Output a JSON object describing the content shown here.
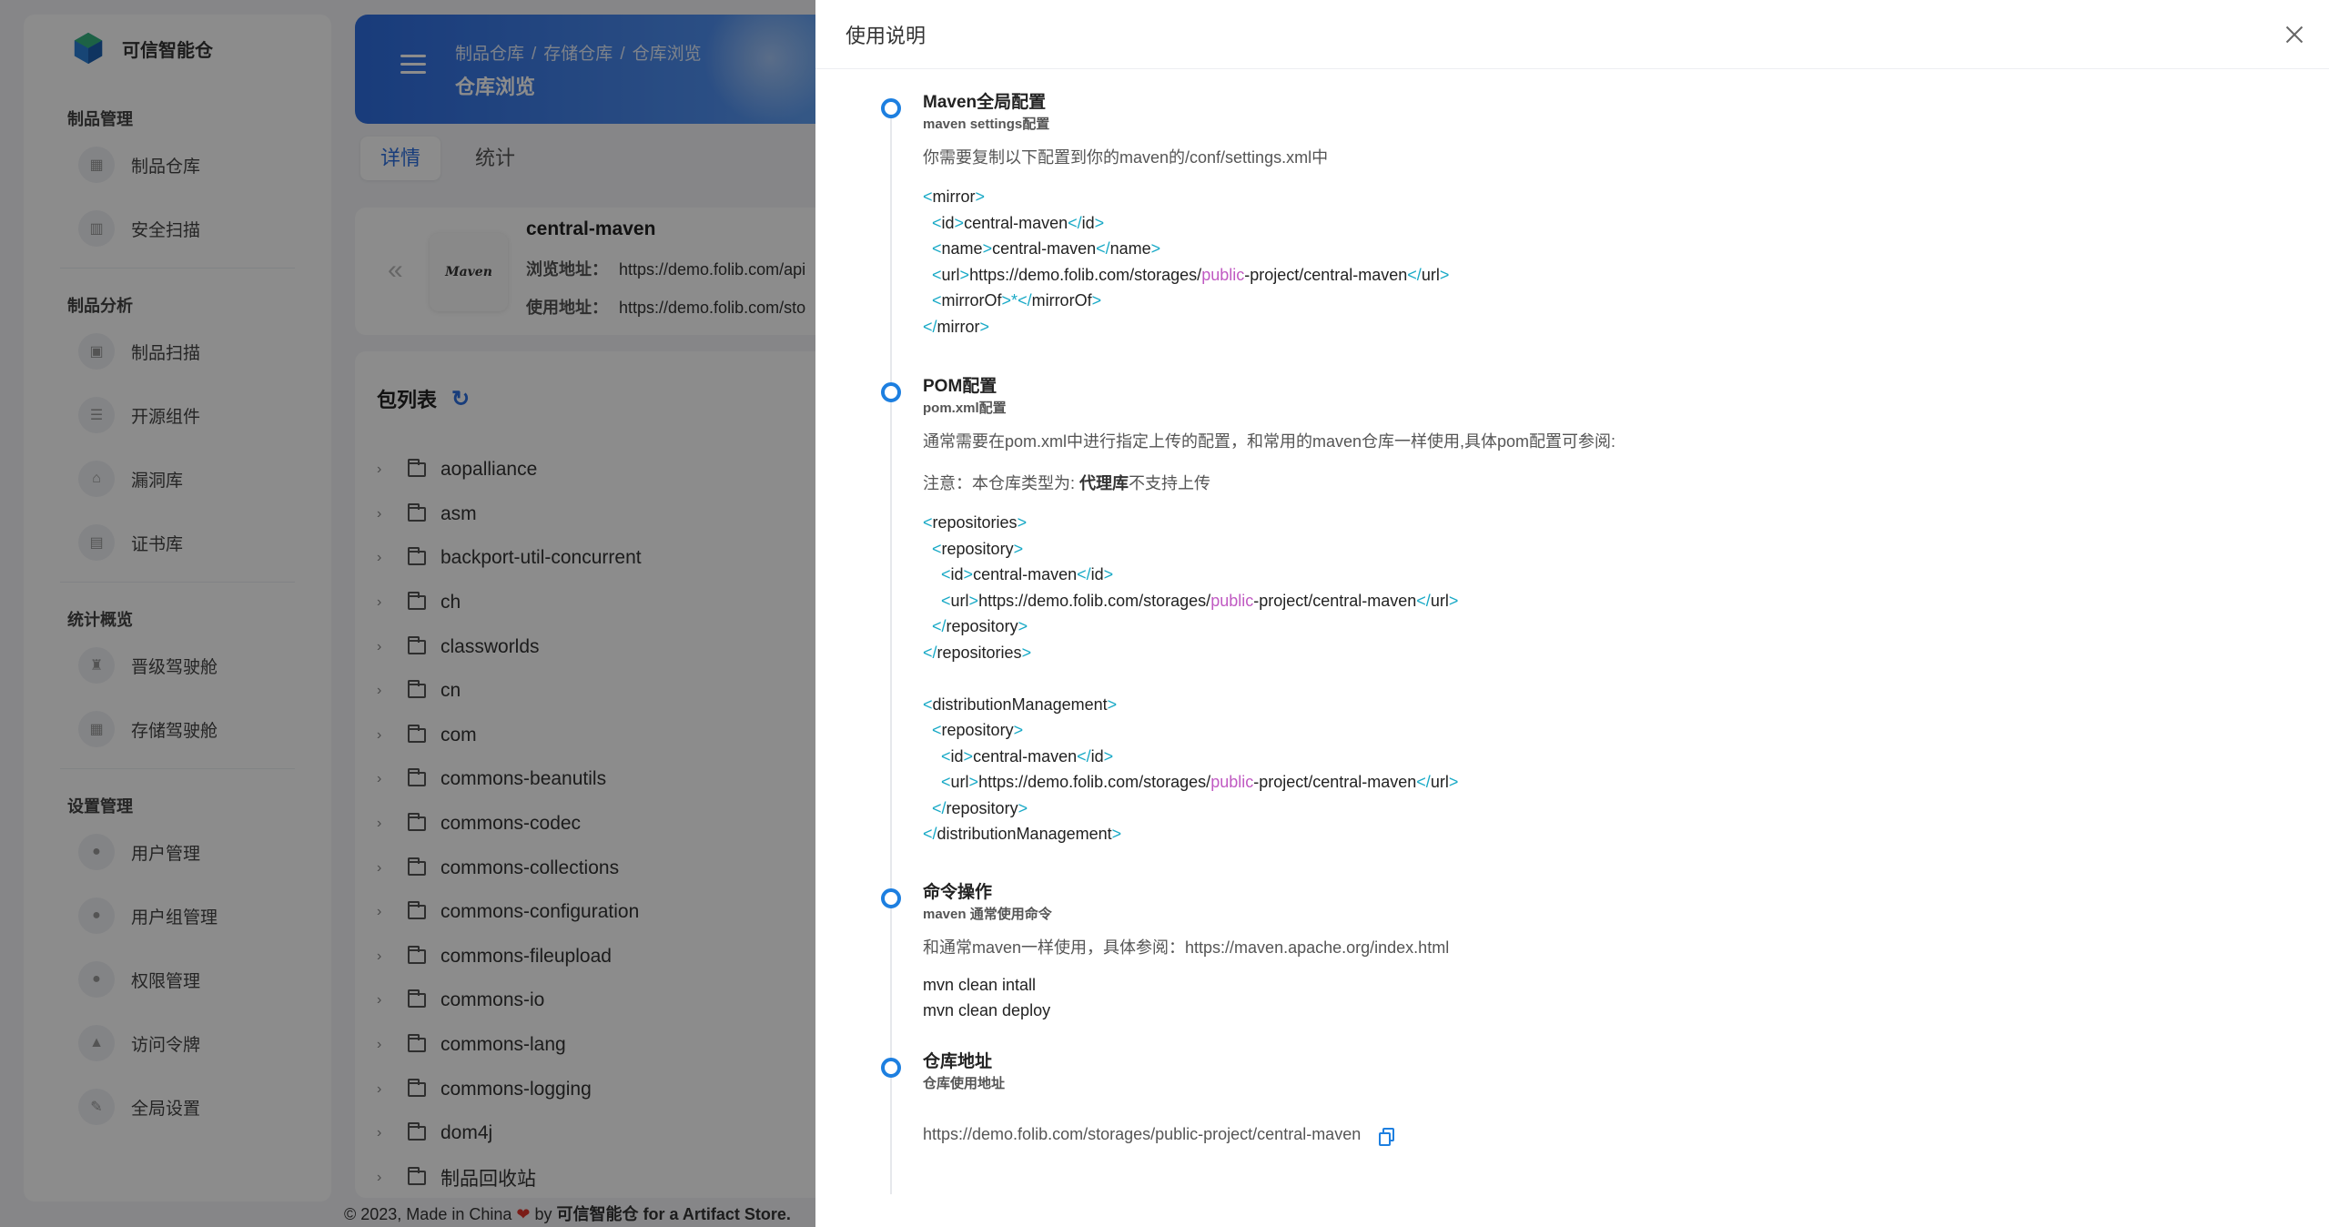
{
  "brand": {
    "name": "可信智能仓"
  },
  "sidebar": {
    "sections": [
      {
        "title": "制品管理",
        "items": [
          {
            "label": "制品仓库"
          },
          {
            "label": "安全扫描"
          }
        ]
      },
      {
        "title": "制品分析",
        "items": [
          {
            "label": "制品扫描"
          },
          {
            "label": "开源组件"
          },
          {
            "label": "漏洞库"
          },
          {
            "label": "证书库"
          }
        ]
      },
      {
        "title": "统计概览",
        "items": [
          {
            "label": "晋级驾驶舱"
          },
          {
            "label": "存储驾驶舱"
          }
        ]
      },
      {
        "title": "设置管理",
        "items": [
          {
            "label": "用户管理"
          },
          {
            "label": "用户组管理"
          },
          {
            "label": "权限管理"
          },
          {
            "label": "访问令牌"
          },
          {
            "label": "全局设置"
          }
        ]
      }
    ]
  },
  "header": {
    "breadcrumbs": [
      "制品仓库",
      "存储仓库",
      "仓库浏览"
    ],
    "title": "仓库浏览"
  },
  "tabs": [
    {
      "label": "详情"
    },
    {
      "label": "统计"
    }
  ],
  "repo": {
    "logo_text": "Maven",
    "name": "central-maven",
    "browse_label": "浏览地址：",
    "browse_url": "https://demo.folib.com/api",
    "use_label": "使用地址：",
    "use_url": "https://demo.folib.com/sto"
  },
  "packages": {
    "title": "包列表",
    "items": [
      "aopalliance",
      "asm",
      "backport-util-concurrent",
      "ch",
      "classworlds",
      "cn",
      "com",
      "commons-beanutils",
      "commons-codec",
      "commons-collections",
      "commons-configuration",
      "commons-fileupload",
      "commons-io",
      "commons-lang",
      "commons-logging",
      "dom4j",
      "制品回收站"
    ]
  },
  "footer": {
    "prefix": "© 2023, Made in China",
    "heart": "❤",
    "by": "by",
    "brand": "可信智能仓",
    "suffix": "for a Artifact Store."
  },
  "drawer": {
    "title": "使用说明",
    "steps": [
      {
        "title": "Maven全局配置",
        "subtitle": "maven settings配置",
        "desc": "你需要复制以下配置到你的maven的/conf/settings.xml中"
      },
      {
        "title": "POM配置",
        "subtitle": "pom.xml配置",
        "desc": "通常需要在pom.xml中进行指定上传的配置，和常用的maven仓库一样使用,具体pom配置可参阅:",
        "note_prefix": "注意：本仓库类型为: ",
        "note_bold": "代理库",
        "note_suffix": "不支持上传"
      },
      {
        "title": "命令操作",
        "subtitle": "maven 通常使用命令",
        "desc": "和通常maven一样使用，具体参阅：https://maven.apache.org/index.html",
        "commands": [
          "mvn clean intall",
          "mvn clean deploy"
        ]
      },
      {
        "title": "仓库地址",
        "subtitle": "仓库使用地址",
        "url": "https://demo.folib.com/storages/public-project/central-maven"
      }
    ],
    "settings_xml": {
      "repo_id": "central-maven",
      "repo_name": "central-maven",
      "url_host": "https://demo.folib.com/storages/",
      "url_m": "public",
      "url_rest": "-project/central-maven",
      "mirror_of": "*"
    },
    "pom_xml": {
      "repo_id": "central-maven",
      "url_host": "https://demo.folib.com/storages/",
      "url_m": "public",
      "url_rest": "-project/central-maven"
    }
  }
}
